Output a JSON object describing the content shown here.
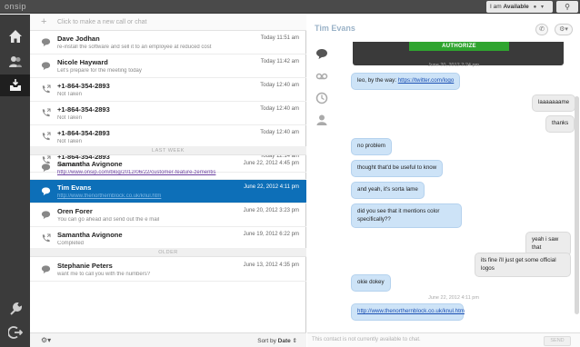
{
  "app": {
    "logo": "onsip"
  },
  "status": {
    "prefix": "I am",
    "value": "Available"
  },
  "new_call": {
    "placeholder": "Click to make a new call or chat"
  },
  "recent": [
    {
      "name": "Dave Jodhan",
      "sub": "re-install the software and sell it to an employee at reduced cost",
      "time": "Today 11:51 am",
      "icon": "chat-bubble-icon"
    },
    {
      "name": "Nicole Hayward",
      "sub": "Let's prepare for the meeting today",
      "time": "Today 11:42 am",
      "icon": "chat-bubble-icon"
    },
    {
      "name": "+1-864-354-2893",
      "sub": "Not Taken",
      "time": "Today 12:40 am",
      "icon": "phone-outgoing-icon"
    },
    {
      "name": "+1-864-354-2893",
      "sub": "Not Taken",
      "time": "Today 12:40 am",
      "icon": "phone-outgoing-icon"
    },
    {
      "name": "+1-864-354-2893",
      "sub": "Not Taken",
      "time": "Today 12:40 am",
      "icon": "phone-outgoing-icon"
    },
    {
      "name": "+1-864-354-2893",
      "sub": "Not Taken",
      "time": "Today 12:14 am",
      "icon": "phone-outgoing-icon"
    }
  ],
  "divider_last_week": "LAST WEEK",
  "last_week": [
    {
      "name": "Samantha Avignone",
      "sub": "http://www.onsip.com/blog/2012/06/22/customer-feature-zementis",
      "time": "June 22, 2012 4:45 pm",
      "icon": "chat-bubble-icon"
    },
    {
      "name": "Tim Evans",
      "sub": "http://www.thenorthernblock.co.uk/knul.htm",
      "time": "June 22, 2012 4:11 pm",
      "icon": "chat-bubble-icon"
    },
    {
      "name": "Oren Forer",
      "sub": "You can go ahead and send out the e mail",
      "time": "June 20, 2012 3:23 pm",
      "icon": "chat-bubble-icon"
    },
    {
      "name": "Samantha Avignone",
      "sub": "Completed",
      "time": "June 19, 2012 6:22 pm",
      "icon": "phone-outgoing-icon"
    }
  ],
  "divider_older": "OLDER",
  "older": [
    {
      "name": "Stephanie Peters",
      "sub": "want me to call you with the numbers?",
      "time": "June 13, 2012 4:35 pm",
      "icon": "chat-bubble-icon"
    }
  ],
  "list_footer": {
    "sort_prefix": "Sort by",
    "sort_value": "Date"
  },
  "chat": {
    "title": "Tim Evans",
    "authorize_label": "AUTHORIZE",
    "stamp_top": "June 20, 2012 2:24 pm",
    "stamp_bottom": "June 22, 2012 4:11 pm",
    "input_placeholder": "This contact is not currently available to chat.",
    "send_label": "SEND"
  },
  "messages": [
    {
      "dir": "in",
      "text": "leo, by the way: ",
      "link": "https://twitter.com/logo"
    },
    {
      "dir": "out",
      "text": "laaaaaaame"
    },
    {
      "dir": "out",
      "text": "thanks"
    },
    {
      "dir": "in",
      "text": "no problem"
    },
    {
      "dir": "in",
      "text": "thought that'd be useful to know"
    },
    {
      "dir": "in",
      "text": "and yeah, it's sorta lame"
    },
    {
      "dir": "in",
      "text": "did you see that it mentions color specifically??"
    },
    {
      "dir": "out",
      "text": "yeah i saw that"
    },
    {
      "dir": "out",
      "text": "its fine i'll just get some official logos"
    },
    {
      "dir": "in",
      "text": "okie dokey"
    },
    {
      "dir": "in",
      "text": "",
      "link": "http://www.thenorthernblock.co.uk/knul.htm"
    }
  ],
  "colors": {
    "selected_row": "#0d6fb8",
    "bubble_in": "#cde3f7",
    "authorize": "#2fa52f"
  }
}
